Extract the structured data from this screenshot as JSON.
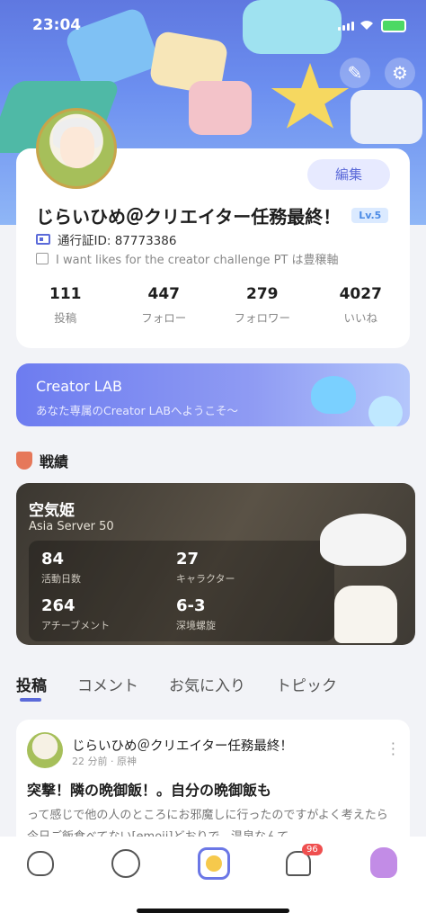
{
  "status_bar": {
    "time": "23:04"
  },
  "profile": {
    "edit_label": "編集",
    "nickname": "じらいひめ＠クリエイター任務最終！",
    "level": "Lv.5",
    "passport_label": "通行証ID: 87773386",
    "bio": "I want likes for the creator challenge PT は豊穣軸",
    "stats": [
      {
        "value": "111",
        "label": "投稿"
      },
      {
        "value": "447",
        "label": "フォロー"
      },
      {
        "value": "279",
        "label": "フォロワー"
      },
      {
        "value": "4027",
        "label": "いいね"
      }
    ]
  },
  "creator_lab": {
    "title": "Creator LAB",
    "subtitle": "あなた専属のCreator LABへようこそ〜"
  },
  "battle_record": {
    "heading": "戦績",
    "game_name": "空気姫",
    "server": "Asia Server 50",
    "stats": [
      {
        "value": "84",
        "label": "活動日数"
      },
      {
        "value": "27",
        "label": "キャラクター"
      },
      {
        "value": "264",
        "label": "アチーブメント"
      },
      {
        "value": "6-3",
        "label": "深境螺旋"
      }
    ]
  },
  "tabs": [
    {
      "label": "投稿",
      "active": true
    },
    {
      "label": "コメント",
      "active": false
    },
    {
      "label": "お気に入り",
      "active": false
    },
    {
      "label": "トピック",
      "active": false
    }
  ],
  "post": {
    "author": "じらいひめ＠クリエイター任務最終！",
    "time": "22 分前",
    "game": "原神",
    "title": "突撃！隣の晩御飯！。自分の晩御飯も",
    "body": "って感じで他の人のところにお邪魔しに行ったのですがよく考えたら今日ご飯食べてない[emoji]どおりで、温泉なんて…"
  },
  "bottom_nav": {
    "notification_badge": "96",
    "items": [
      "home-icon",
      "planet-icon",
      "create-icon",
      "bell-icon",
      "profile-icon"
    ]
  },
  "colors": {
    "accent": "#5b6ad9",
    "badge": "#ef4f4f",
    "level_bg": "#dbeaff"
  }
}
